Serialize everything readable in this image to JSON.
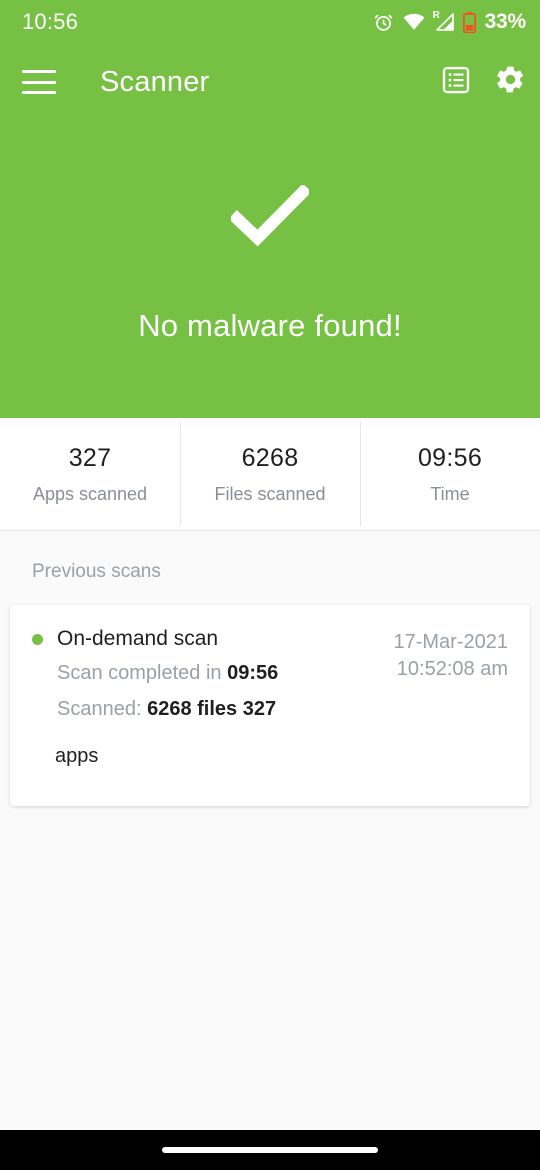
{
  "theme": {
    "brand_green": "#76c043",
    "white": "#ffffff",
    "battery_red": "#f4511e",
    "muted_gray": "#9aa0a6"
  },
  "status_bar": {
    "time": "10:56",
    "battery_percent": "33%",
    "roaming_label": "R",
    "icons": [
      "alarm-icon",
      "wifi-icon",
      "cellular-signal-icon",
      "battery-icon"
    ]
  },
  "app_bar": {
    "menu_icon": "hamburger-menu-icon",
    "title": "Scanner",
    "actions": [
      {
        "name": "scan-report-icon",
        "label": "Scan report"
      },
      {
        "name": "gear-icon",
        "label": "Settings"
      }
    ]
  },
  "hero": {
    "status_icon": "checkmark-icon",
    "message": "No malware found!"
  },
  "stats": [
    {
      "value": "327",
      "label": "Apps scanned"
    },
    {
      "value": "6268",
      "label": "Files scanned"
    },
    {
      "value": "09:56",
      "label": "Time"
    }
  ],
  "previous_scans": {
    "section_title": "Previous scans",
    "items": [
      {
        "status_dot": "green",
        "title": "On-demand scan",
        "completed_label": "Scan completed in",
        "completed_value": "09:56",
        "scanned_label": "Scanned:",
        "scanned_value": "6268 files 327",
        "scanned_wrap": "apps",
        "date": "17-Mar-2021",
        "time": "10:52:08 am"
      }
    ]
  },
  "nav_bar": {
    "gesture_handle": "home-gesture-pill"
  }
}
